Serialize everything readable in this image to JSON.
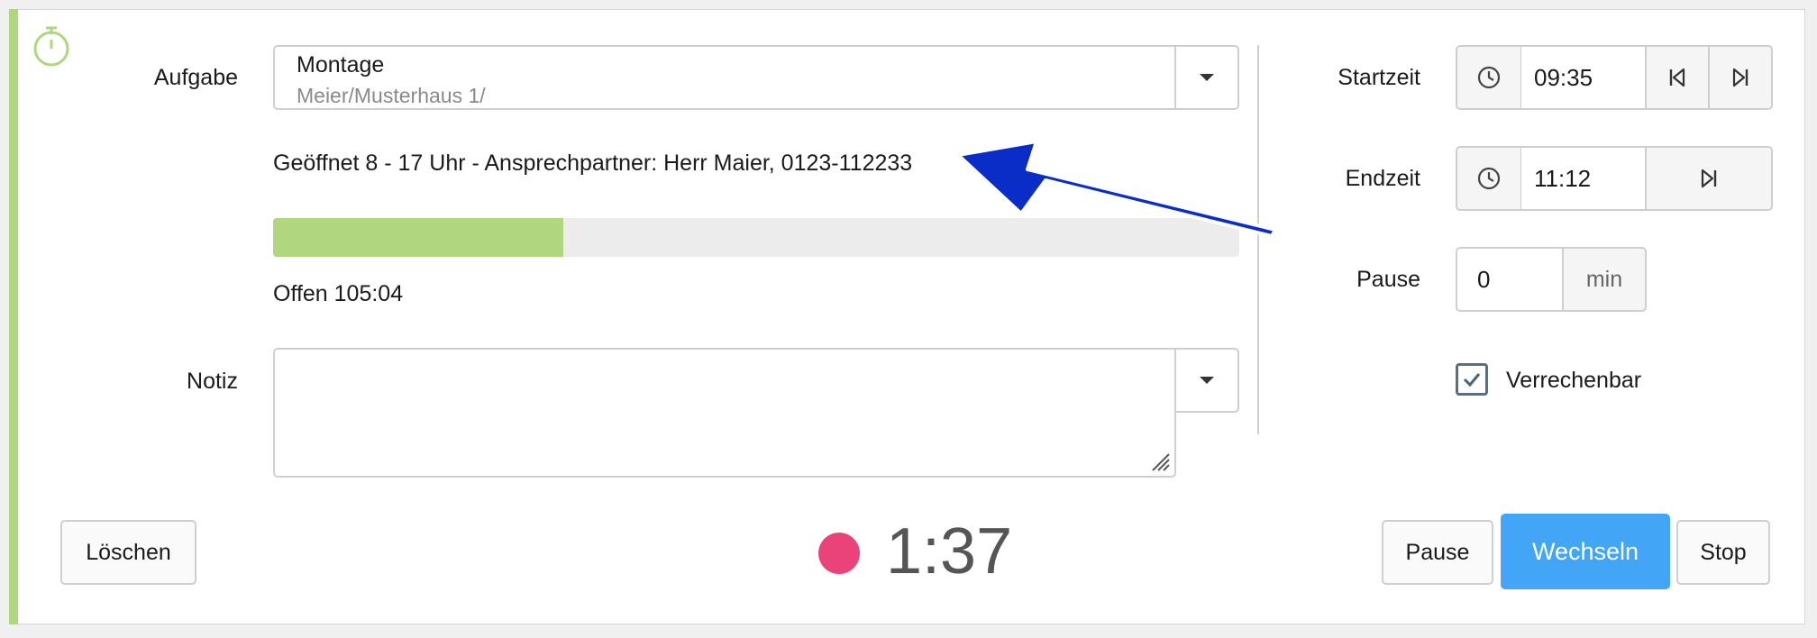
{
  "task": {
    "label": "Aufgabe",
    "title": "Montage",
    "subtitle": "Meier/Musterhaus 1/"
  },
  "info_text": "Geöffnet 8 - 17 Uhr - Ansprechpartner: Herr Maier, 0123-112233",
  "progress": {
    "fraction": 0.3,
    "color": "#b0d67f"
  },
  "open_text": "Offen 105:04",
  "note": {
    "label": "Notiz",
    "value": ""
  },
  "start": {
    "label": "Startzeit",
    "value": "09:35"
  },
  "end": {
    "label": "Endzeit",
    "value": "11:12"
  },
  "pause": {
    "label": "Pause",
    "value": "0",
    "unit": "min"
  },
  "billable": {
    "label": "Verrechenbar",
    "checked": true
  },
  "buttons": {
    "delete": "Löschen",
    "pause": "Pause",
    "switch": "Wechseln",
    "stop": "Stop"
  },
  "timer": {
    "value": "1:37",
    "dot_color": "#e9437a"
  },
  "colors": {
    "accent": "#b0d67f",
    "primary": "#42a5f5",
    "annotation_arrow": "#0a2cc7"
  }
}
